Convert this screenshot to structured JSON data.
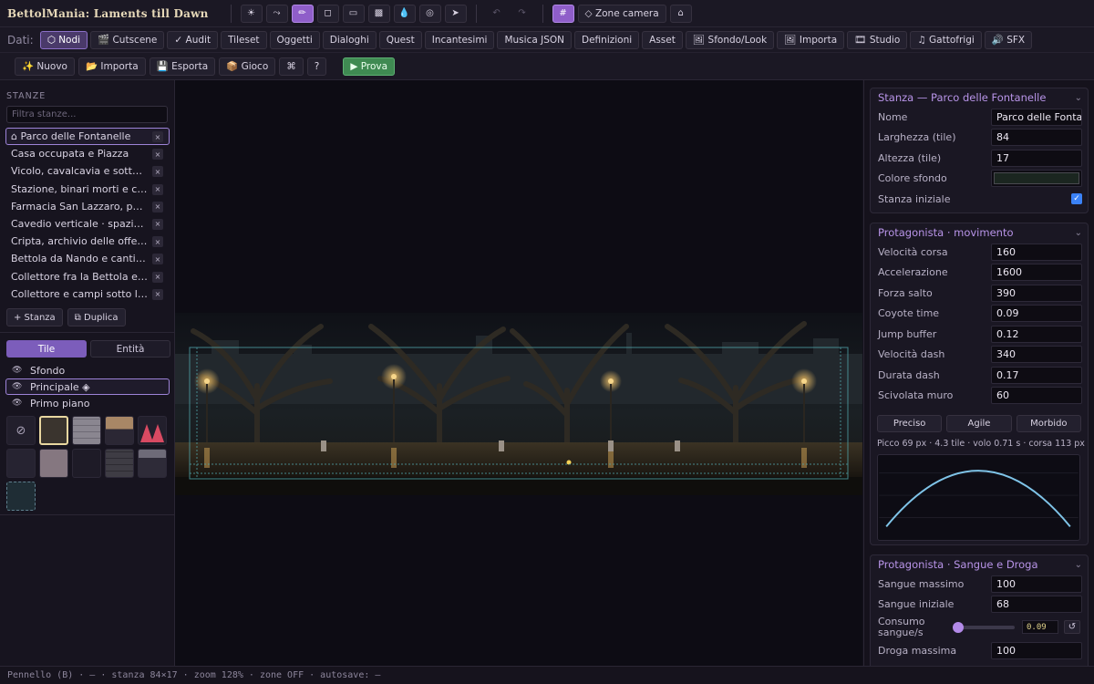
{
  "app": {
    "title": "BettolMania: Laments till Dawn"
  },
  "tools": {
    "items": [
      {
        "name": "sun-tool",
        "glyph": "☀",
        "active": false
      },
      {
        "name": "path-tool",
        "glyph": "⤳",
        "active": false
      },
      {
        "name": "brush-tool",
        "glyph": "✏",
        "active": true
      },
      {
        "name": "square-tool",
        "glyph": "◻",
        "active": false
      },
      {
        "name": "rect-tool",
        "glyph": "▭",
        "active": false
      },
      {
        "name": "fill-rect-tool",
        "glyph": "▩",
        "active": false
      },
      {
        "name": "bucket-tool",
        "glyph": "💧",
        "active": false
      },
      {
        "name": "circle-tool",
        "glyph": "◎",
        "active": false
      },
      {
        "name": "pointer-tool",
        "glyph": "➤",
        "active": false
      }
    ],
    "undo": "↶",
    "redo": "↷",
    "grid": "#",
    "zone_camera": "◇ Zone camera",
    "home": "⌂"
  },
  "databar": {
    "label": "Dati:",
    "tabs": [
      {
        "label": "⬡ Nodi",
        "active": true
      },
      {
        "label": "🎬 Cutscene",
        "active": false
      },
      {
        "label": "✓ Audit",
        "active": false
      },
      {
        "label": "Tileset",
        "active": false
      },
      {
        "label": "Oggetti",
        "active": false
      },
      {
        "label": "Dialoghi",
        "active": false
      },
      {
        "label": "Quest",
        "active": false
      },
      {
        "label": "Incantesimi",
        "active": false
      },
      {
        "label": "Musica JSON",
        "active": false
      },
      {
        "label": "Definizioni",
        "active": false
      },
      {
        "label": "Asset",
        "active": false
      },
      {
        "label": "🖼 Sfondo/Look",
        "active": false
      },
      {
        "label": "🖼 Importa",
        "active": false
      },
      {
        "label": "🎞 Studio",
        "active": false
      },
      {
        "label": "♫ Gattofrigi",
        "active": false
      },
      {
        "label": "🔊 SFX",
        "active": false
      }
    ]
  },
  "filebar": {
    "new": "✨ Nuovo",
    "import": "📂 Importa",
    "export": "💾 Esporta",
    "game": "📦 Gioco",
    "cmd": "⌘",
    "help": "?",
    "play": "▶ Prova"
  },
  "sidebar": {
    "rooms_title": "STANZE",
    "filter_placeholder": "Filtra stanze...",
    "rooms": [
      {
        "name": "⌂ Parco delle Fontanelle",
        "active": true
      },
      {
        "name": "Casa occupata e Piazza",
        "active": false
      },
      {
        "name": "Vicolo, cavalcavia e sottopassaggio",
        "active": false
      },
      {
        "name": "Stazione, binari morti e capannone",
        "active": false
      },
      {
        "name": "Farmacia San Lazzaro, parcheggio",
        "active": false
      },
      {
        "name": "Cavedio verticale · spazio tra i palazzi",
        "active": false
      },
      {
        "name": "Cripta, archivio delle offerte",
        "active": false
      },
      {
        "name": "Bettola da Nando e cantine",
        "active": false
      },
      {
        "name": "Collettore fra la Bettola e il fiume",
        "active": false
      },
      {
        "name": "Collettore e campi sotto la città",
        "active": false
      }
    ],
    "delete_glyph": "×",
    "add_room": "+ Stanza",
    "duplicate": "⧉ Duplica",
    "mode_tabs": [
      "Tile",
      "Entità"
    ],
    "layers": [
      {
        "name": "Sfondo",
        "active": false
      },
      {
        "name": "Principale ◈",
        "active": true
      },
      {
        "name": "Primo piano",
        "active": false
      }
    ],
    "eye_glyph": "👁",
    "erase_glyph": "⊘"
  },
  "props": {
    "room": {
      "title": "Stanza — Parco delle Fontanelle",
      "fields": [
        {
          "label": "Nome",
          "value": "Parco delle Fontanelle"
        },
        {
          "label": "Larghezza (tile)",
          "value": "84"
        },
        {
          "label": "Altezza (tile)",
          "value": "17"
        }
      ],
      "bg_color_label": "Colore sfondo",
      "bg_color": "#1b2620",
      "initial_label": "Stanza iniziale",
      "initial": true
    },
    "movement": {
      "title": "Protagonista · movimento",
      "fields": [
        {
          "label": "Velocità corsa",
          "value": "160"
        },
        {
          "label": "Accelerazione",
          "value": "1600"
        },
        {
          "label": "Forza salto",
          "value": "390"
        },
        {
          "label": "Coyote time",
          "value": "0.09"
        },
        {
          "label": "Jump buffer",
          "value": "0.12"
        },
        {
          "label": "Velocità dash",
          "value": "340"
        },
        {
          "label": "Durata dash",
          "value": "0.17"
        },
        {
          "label": "Scivolata muro",
          "value": "60"
        }
      ],
      "presets": [
        "Preciso",
        "Agile",
        "Morbido"
      ],
      "stats": "Picco 69 px · 4.3 tile · volo 0.71 s · corsa 113 px"
    },
    "blood": {
      "title": "Protagonista · Sangue e Droga",
      "fields": [
        {
          "label": "Sangue massimo",
          "value": "100"
        },
        {
          "label": "Sangue iniziale",
          "value": "68"
        }
      ],
      "drain_label": "Consumo sangue/s",
      "drain_value": "0.09",
      "drain_fraction": 0.0,
      "reset": "↺",
      "drug_max_label": "Droga massima",
      "drug_max_value": "100"
    },
    "chevron": "⌄"
  },
  "status": "Pennello (B) · — · stanza 84×17 · zoom 128% · zone OFF · autosave: —",
  "colors": {
    "accent": "#8f5ec9",
    "play": "#3f8a52",
    "section_title": "#b894e8",
    "jump_curve": "#7fc4e8",
    "zone_outline": "#4fa3a8"
  }
}
